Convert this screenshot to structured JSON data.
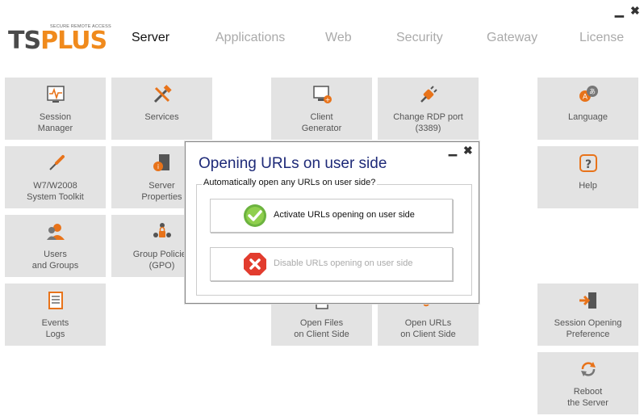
{
  "window": {
    "minimize": "▁",
    "close": "✖"
  },
  "brand": {
    "name_part1": "TS",
    "name_part2": "PLUS",
    "tagline": "SECURE REMOTE ACCESS"
  },
  "tabs": [
    {
      "label": "Server",
      "active": true
    },
    {
      "label": "Applications"
    },
    {
      "label": "Web"
    },
    {
      "label": "Security"
    },
    {
      "label": "Gateway"
    },
    {
      "label": "License"
    }
  ],
  "tiles": {
    "session_manager": "Session\nManager",
    "services": "Services",
    "client_generator": "Client\nGenerator",
    "rdp_port": "Change RDP port\n(3389)",
    "language": "Language",
    "toolkit": "W7/W2008\nSystem Toolkit",
    "server_properties": "Server\nProperties",
    "help": "Help",
    "users_groups": "Users\nand Groups",
    "group_policies": "Group Policies\n(GPO)",
    "events_logs": "Events\nLogs",
    "open_files": "Open Files\non Client Side",
    "open_urls": "Open URLs\non Client Side",
    "session_preference": "Session Opening\nPreference",
    "reboot": "Reboot\nthe Server"
  },
  "dialog": {
    "title": "Opening URLs on user side",
    "minimize": "▁",
    "close": "✖",
    "question": "Automatically open any URLs on user side?",
    "activate_label": "Activate URLs opening on user side",
    "disable_label": "Disable URLs opening on user side"
  },
  "colors": {
    "accent": "#f08a1c",
    "dialog_title": "#1e2a78",
    "tile_bg": "#e3e3e3",
    "tab_inactive": "#aaaaaa"
  }
}
